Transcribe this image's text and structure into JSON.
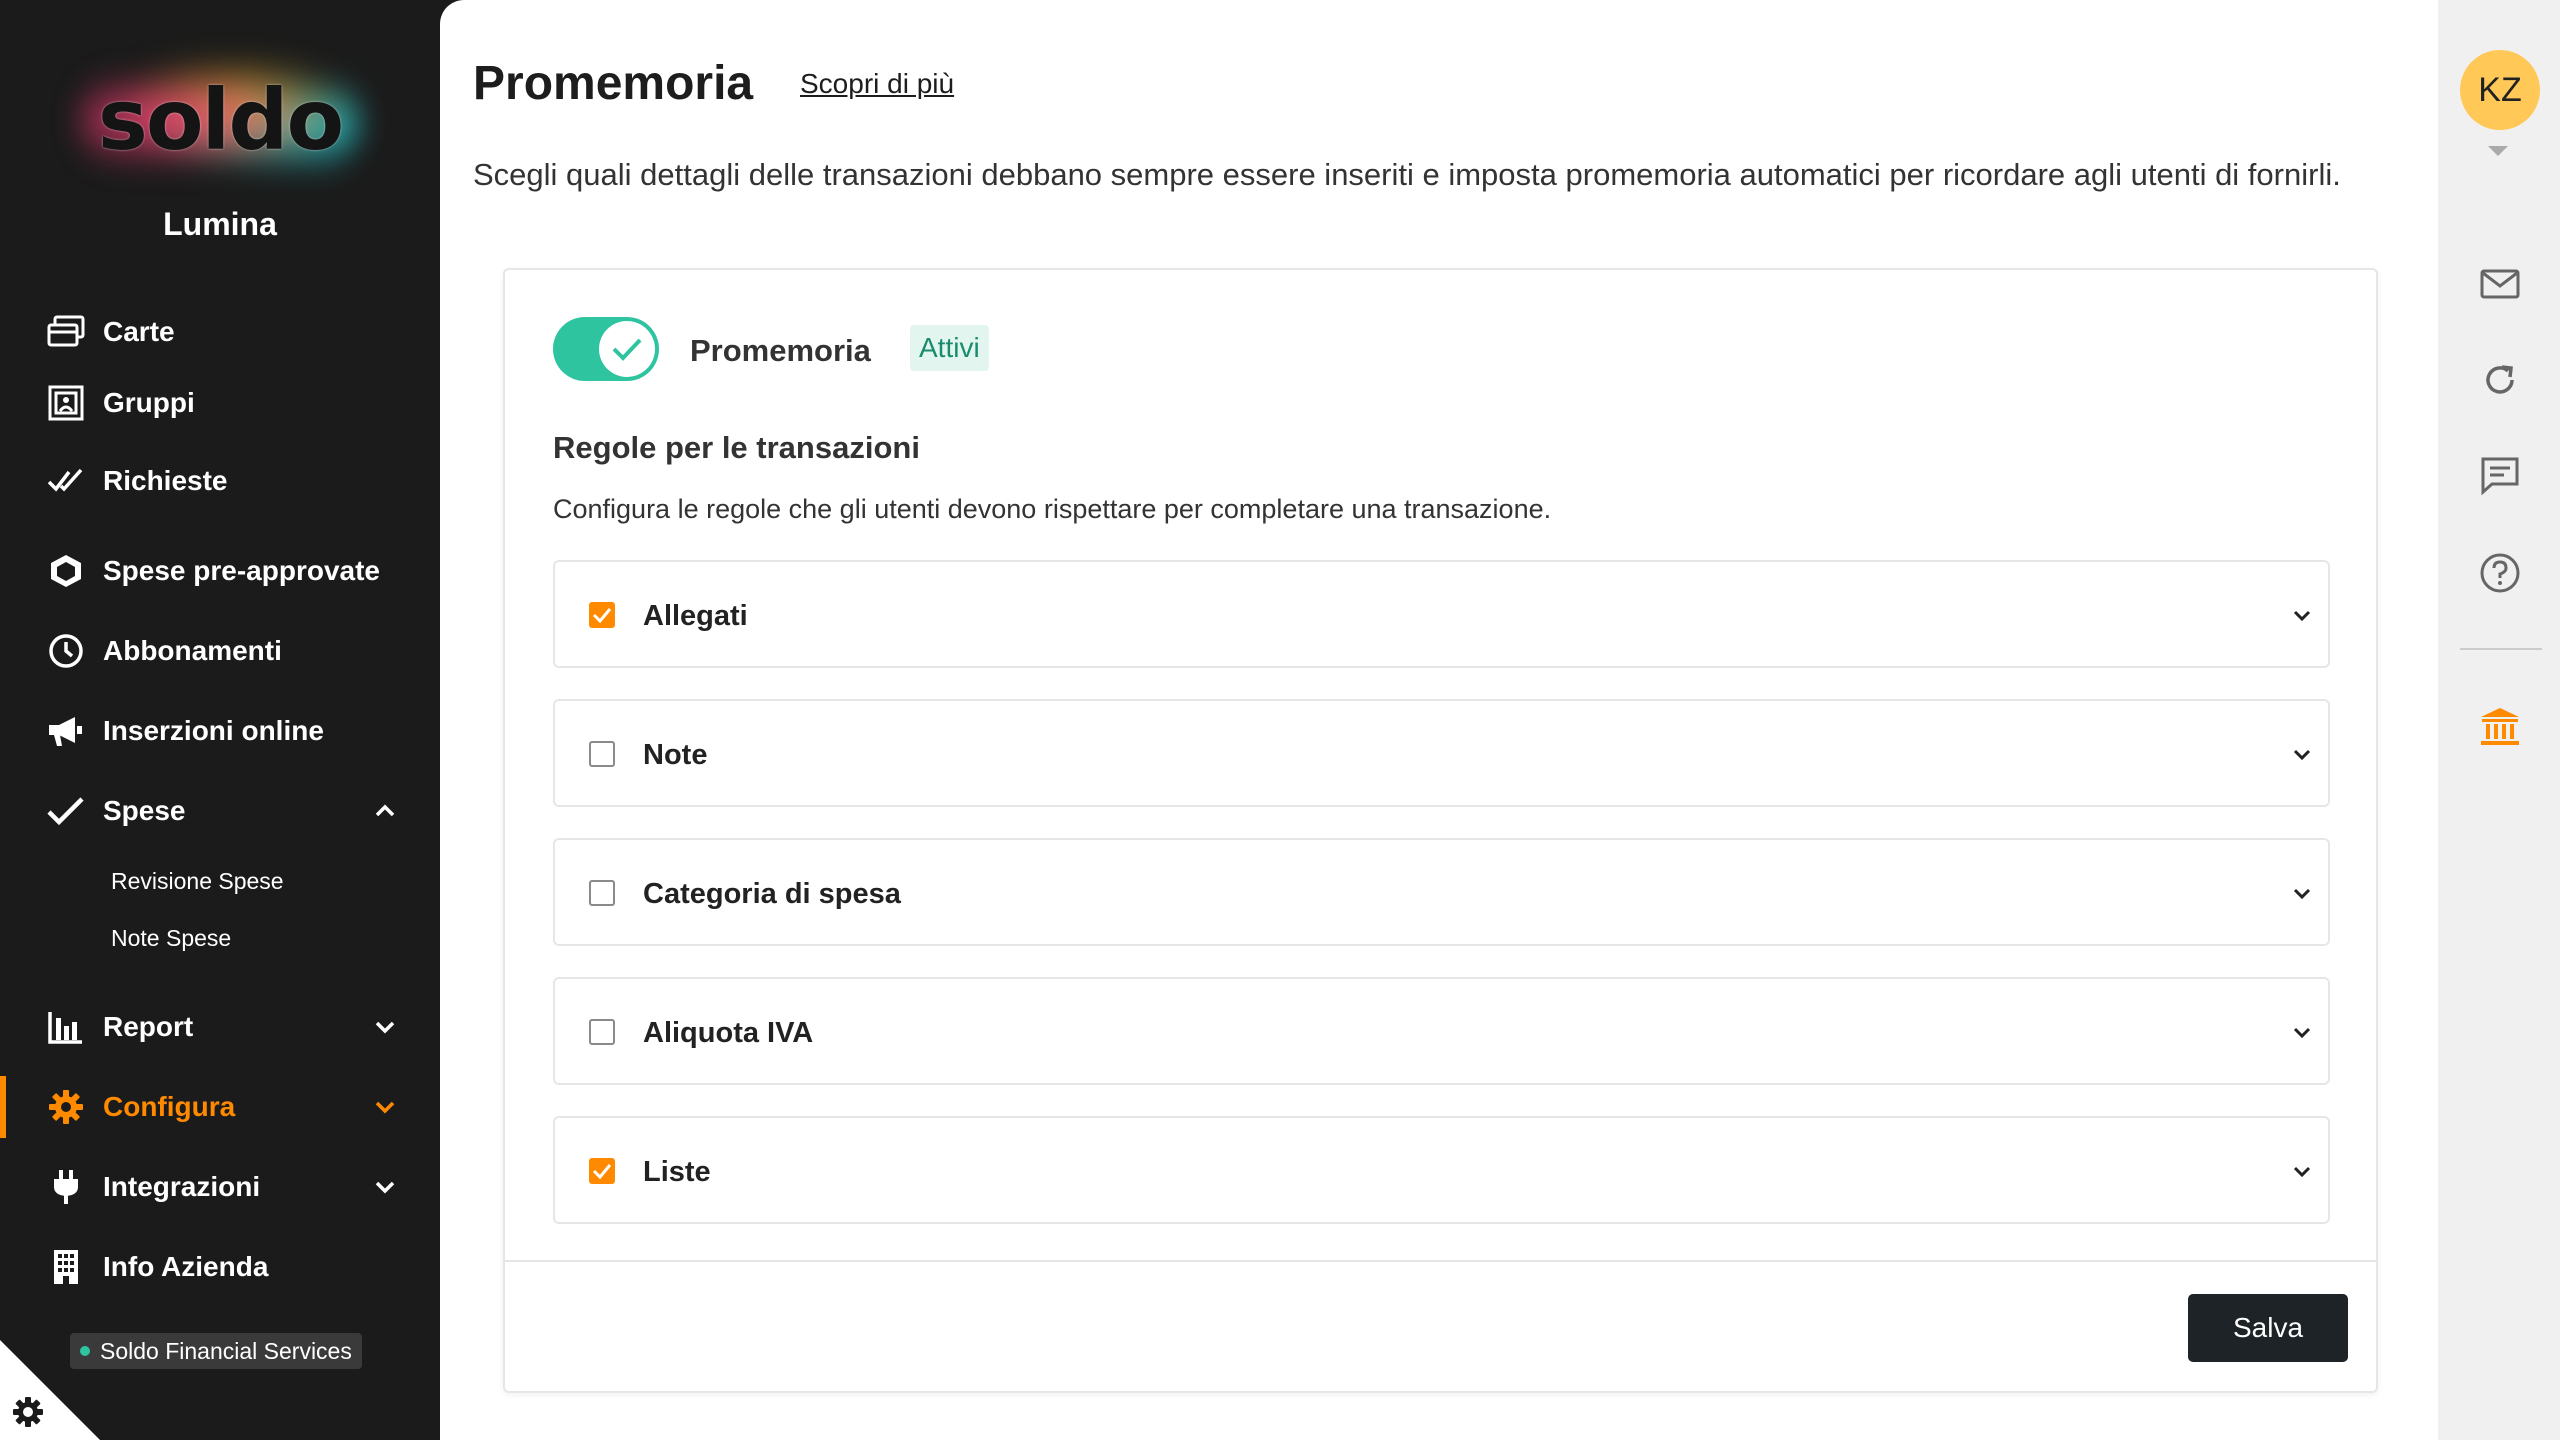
{
  "sidebar": {
    "brand": "soldo",
    "org_name": "Lumina",
    "nav": [
      {
        "label": "Carte",
        "icon": "cards-icon"
      },
      {
        "label": "Gruppi",
        "icon": "groups-icon"
      },
      {
        "label": "Richieste",
        "icon": "double-check-icon"
      },
      {
        "label": "Spese pre-approvate",
        "icon": "shield-icon"
      },
      {
        "label": "Abbonamenti",
        "icon": "clock-icon"
      },
      {
        "label": "Inserzioni online",
        "icon": "megaphone-icon"
      },
      {
        "label": "Spese",
        "icon": "check-icon",
        "expanded": true
      },
      {
        "label": "Report",
        "icon": "bar-chart-icon"
      },
      {
        "label": "Configura",
        "icon": "gear-icon",
        "active": true
      },
      {
        "label": "Integrazioni",
        "icon": "plug-icon"
      },
      {
        "label": "Info Azienda",
        "icon": "building-icon"
      }
    ],
    "sub_items": [
      "Revisione Spese",
      "Note Spese"
    ],
    "entity": "Soldo Financial Services"
  },
  "main": {
    "title": "Promemoria",
    "learn_more": "Scopri di più",
    "description": "Scegli quali dettagli delle transazioni debbano sempre essere inseriti e imposta promemoria automatici per ricordare agli utenti di fornirli.",
    "toggle": {
      "label": "Promemoria",
      "status": "Attivi",
      "on": true
    },
    "rules": {
      "title": "Regole per le transazioni",
      "description": "Configura le regole che gli utenti devono rispettare per completare una transazione.",
      "items": [
        {
          "label": "Allegati",
          "checked": true
        },
        {
          "label": "Note",
          "checked": false
        },
        {
          "label": "Categoria di spesa",
          "checked": false
        },
        {
          "label": "Aliquota IVA",
          "checked": false
        },
        {
          "label": "Liste",
          "checked": true
        }
      ]
    },
    "save_label": "Salva"
  },
  "rail": {
    "avatar_initials": "KZ",
    "icons": [
      "mail-icon",
      "refresh-icon",
      "chat-icon",
      "help-icon",
      "bank-icon"
    ]
  },
  "colors": {
    "accent": "#ff8a00",
    "toggle_on": "#2ec4a0",
    "sidebar_bg": "#1b1b1b",
    "avatar_bg": "#ffc857"
  }
}
